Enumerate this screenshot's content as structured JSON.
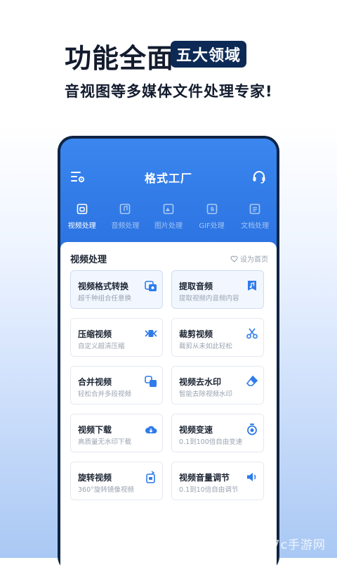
{
  "hero": {
    "title": "功能全面",
    "badge": "五大领域",
    "subtitle": "音视图等多媒体文件处理专家!"
  },
  "app": {
    "title": "格式工厂",
    "menu_icon": "menu-settings-icon",
    "support_icon": "headset-icon"
  },
  "tabs": [
    {
      "label": "视频处理",
      "icon": "video-icon",
      "active": true
    },
    {
      "label": "音频处理",
      "icon": "audio-icon",
      "active": false
    },
    {
      "label": "图片处理",
      "icon": "image-icon",
      "active": false
    },
    {
      "label": "GIF处理",
      "icon": "gif-icon",
      "active": false
    },
    {
      "label": "文档处理",
      "icon": "document-icon",
      "active": false
    }
  ],
  "section": {
    "title": "视频处理",
    "set_home": "设为首页"
  },
  "cards": [
    {
      "title": "视频格式转换",
      "desc": "超千种组合任意换",
      "icon": "video-convert-icon"
    },
    {
      "title": "提取音频",
      "desc": "提取视频内音频内容",
      "icon": "extract-audio-icon"
    },
    {
      "title": "压缩视频",
      "desc": "自定义超清压缩",
      "icon": "compress-icon"
    },
    {
      "title": "裁剪视频",
      "desc": "裁剪从未如此轻松",
      "icon": "scissors-icon"
    },
    {
      "title": "合并视频",
      "desc": "轻松合并多段视频",
      "icon": "merge-icon"
    },
    {
      "title": "视频去水印",
      "desc": "智能去除视频水印",
      "icon": "eraser-icon"
    },
    {
      "title": "视频下载",
      "desc": "高质量无水印下载",
      "icon": "cloud-download-icon"
    },
    {
      "title": "视频变速",
      "desc": "0.1到100倍自由变速",
      "icon": "speed-icon"
    },
    {
      "title": "旋转视频",
      "desc": "360°旋转镜像视频",
      "icon": "rotate-icon"
    },
    {
      "title": "视频音量调节",
      "desc": "0.1到10倍自由调节",
      "icon": "volume-icon"
    }
  ],
  "watermark": "997c手游网",
  "colors": {
    "primary": "#2f7bea",
    "badge_bg": "#0d2a56",
    "phone_frame": "#0f2443",
    "text_dark": "#1d2533",
    "text_muted": "#9aa3b1"
  }
}
